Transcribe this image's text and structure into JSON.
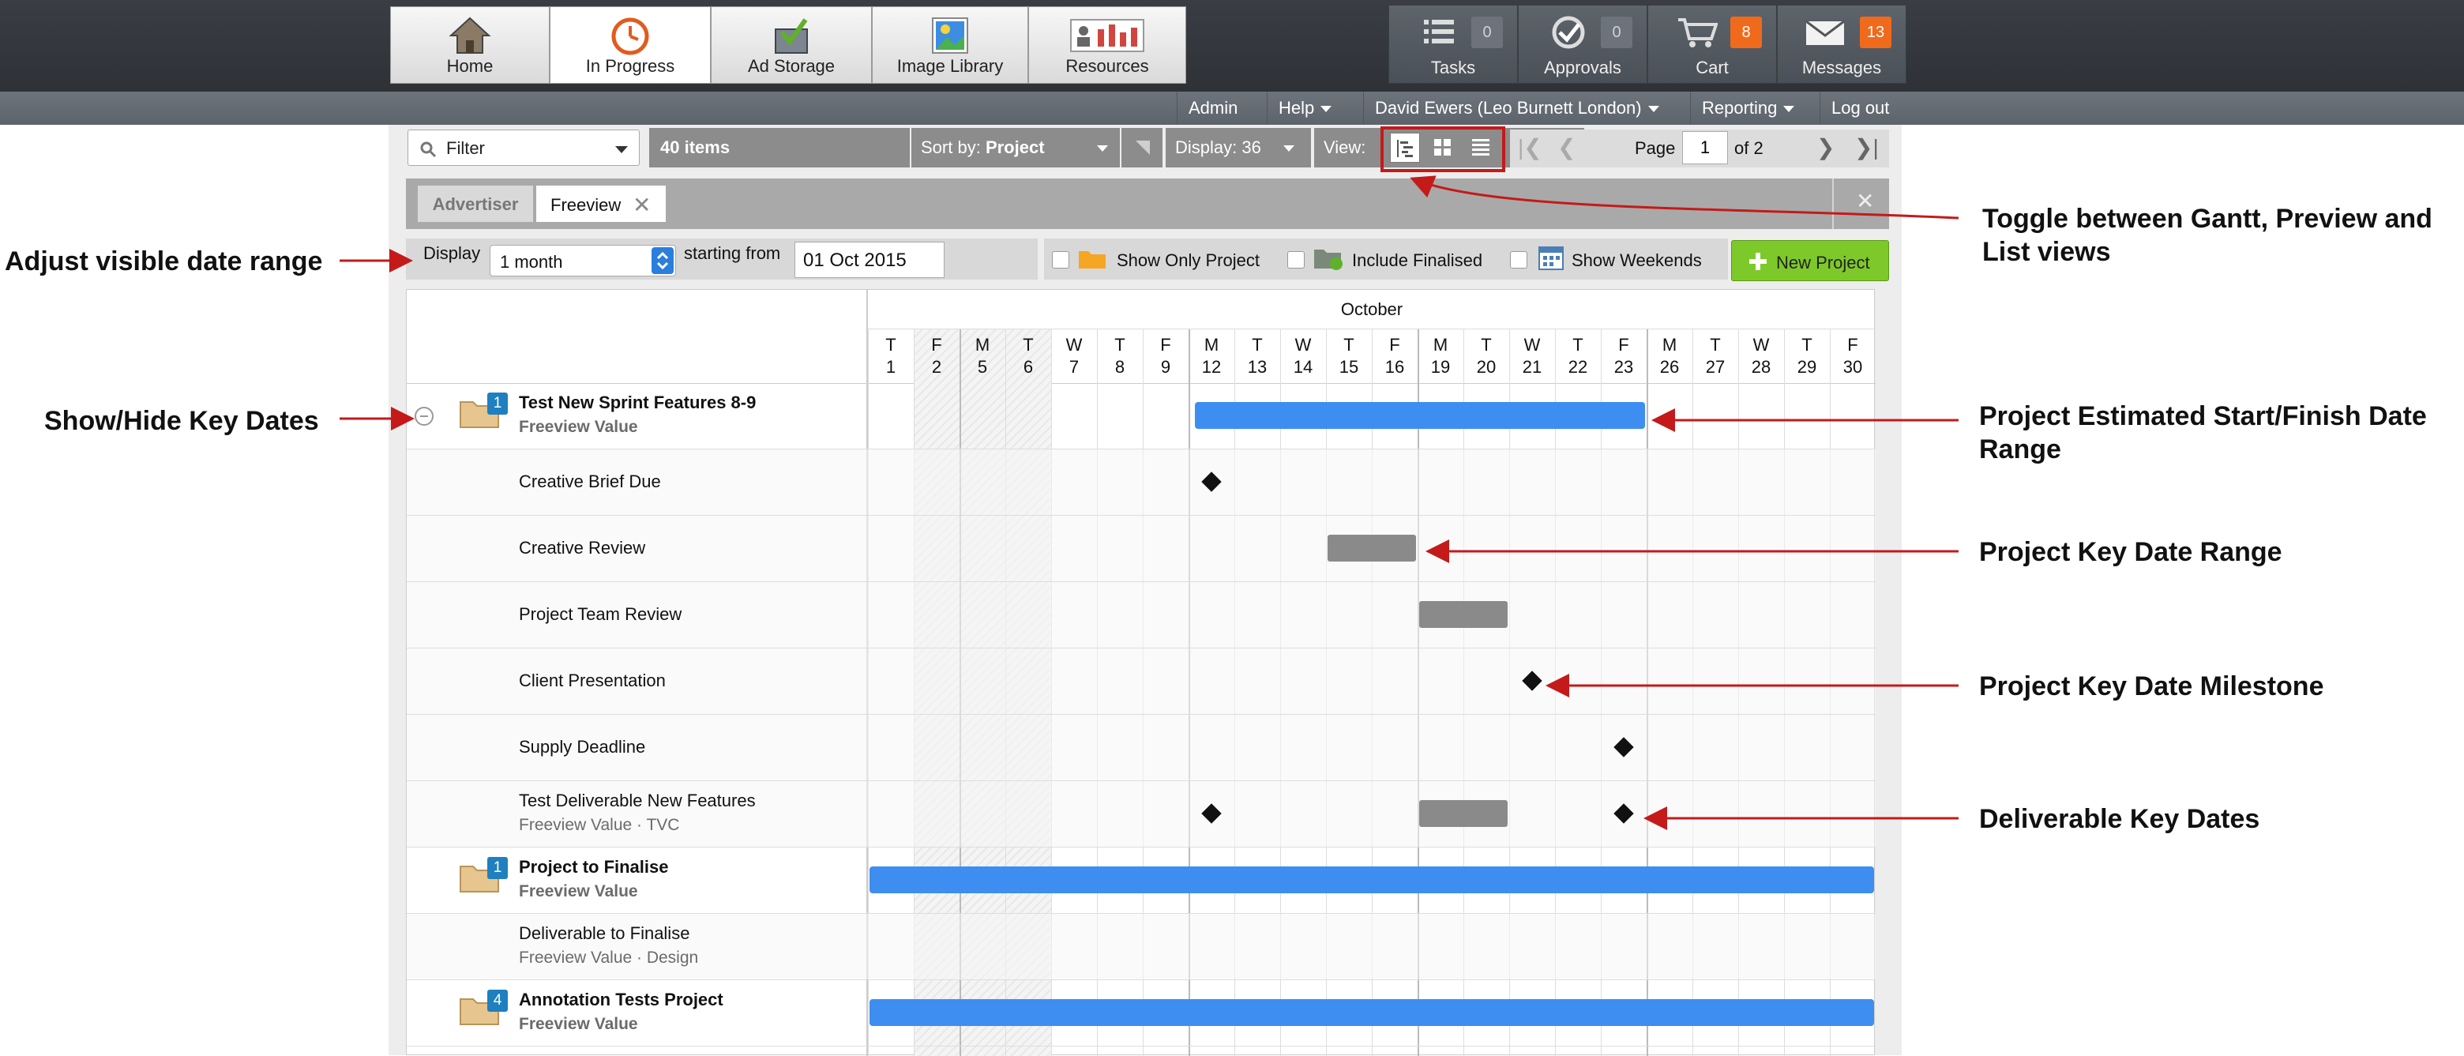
{
  "nav": {
    "tabs": [
      {
        "label": "Home",
        "icon": "home-icon"
      },
      {
        "label": "In Progress",
        "icon": "clock-icon"
      },
      {
        "label": "Ad Storage",
        "icon": "box-icon"
      },
      {
        "label": "Image Library",
        "icon": "image-icon"
      },
      {
        "label": "Resources",
        "icon": "resources-icon"
      }
    ],
    "active_tab": "In Progress"
  },
  "quick": [
    {
      "label": "Tasks",
      "count": "0",
      "icon": "list-icon"
    },
    {
      "label": "Approvals",
      "count": "0",
      "icon": "approval-icon"
    },
    {
      "label": "Cart",
      "count": "8",
      "icon": "cart-icon"
    },
    {
      "label": "Messages",
      "count": "13",
      "icon": "envelope-icon"
    }
  ],
  "menu": {
    "admin": "Admin",
    "help": "Help",
    "user": "David Ewers (Leo Burnett London)",
    "reporting": "Reporting",
    "logout": "Log out"
  },
  "toolbar": {
    "filter": "Filter",
    "items": "40 items",
    "sort_prefix": "Sort by:",
    "sort_value": "Project",
    "display": "Display: 36",
    "view": "View:",
    "page_label": "Page",
    "page_value": "1",
    "page_of": "of 2"
  },
  "filters": {
    "advertiser": "Advertiser",
    "chip": "Freeview"
  },
  "range": {
    "display_label": "Display",
    "display_value": "1 month",
    "starting_from": "starting from",
    "date": "01 Oct 2015",
    "show_only_project": "Show Only Project",
    "include_finalised": "Include Finalised",
    "show_weekends": "Show Weekends",
    "new_project": "New Project"
  },
  "gantt": {
    "month": "October",
    "days": [
      {
        "d": "T",
        "n": "1"
      },
      {
        "d": "F",
        "n": "2"
      },
      {
        "d": "M",
        "n": "5"
      },
      {
        "d": "T",
        "n": "6"
      },
      {
        "d": "W",
        "n": "7"
      },
      {
        "d": "T",
        "n": "8"
      },
      {
        "d": "F",
        "n": "9"
      },
      {
        "d": "M",
        "n": "12"
      },
      {
        "d": "T",
        "n": "13"
      },
      {
        "d": "W",
        "n": "14"
      },
      {
        "d": "T",
        "n": "15"
      },
      {
        "d": "F",
        "n": "16"
      },
      {
        "d": "M",
        "n": "19"
      },
      {
        "d": "T",
        "n": "20"
      },
      {
        "d": "W",
        "n": "21"
      },
      {
        "d": "T",
        "n": "22"
      },
      {
        "d": "F",
        "n": "23"
      },
      {
        "d": "M",
        "n": "26"
      },
      {
        "d": "T",
        "n": "27"
      },
      {
        "d": "W",
        "n": "28"
      },
      {
        "d": "T",
        "n": "29"
      },
      {
        "d": "F",
        "n": "30"
      }
    ],
    "rows": [
      {
        "type": "project",
        "title": "Test New Sprint Features 8-9",
        "sub": "Freeview Value",
        "count": "1",
        "bars": [
          {
            "kind": "blue",
            "from": "12",
            "to": "23"
          }
        ]
      },
      {
        "type": "key",
        "title": "Creative Brief Due",
        "marks": [
          {
            "kind": "diamond",
            "at": "12"
          }
        ]
      },
      {
        "type": "key",
        "title": "Creative Review",
        "bars": [
          {
            "kind": "gray",
            "from": "15",
            "to": "16"
          }
        ]
      },
      {
        "type": "key",
        "title": "Project Team Review",
        "bars": [
          {
            "kind": "gray",
            "from": "19",
            "to": "20"
          }
        ]
      },
      {
        "type": "key",
        "title": "Client Presentation",
        "marks": [
          {
            "kind": "diamond",
            "at": "21"
          }
        ]
      },
      {
        "type": "key",
        "title": "Supply Deadline",
        "marks": [
          {
            "kind": "diamond",
            "at": "23"
          }
        ]
      },
      {
        "type": "deliverable",
        "title": "Test Deliverable New Features",
        "sub": "Freeview Value · TVC",
        "marks": [
          {
            "kind": "diamond",
            "at": "12"
          },
          {
            "kind": "diamond",
            "at": "23"
          }
        ],
        "bars": [
          {
            "kind": "gray",
            "from": "19",
            "to": "20"
          }
        ]
      },
      {
        "type": "project",
        "title": "Project to Finalise",
        "sub": "Freeview Value",
        "count": "1",
        "bars": [
          {
            "kind": "blue",
            "from": "1",
            "to": "30"
          }
        ]
      },
      {
        "type": "deliverable",
        "title": "Deliverable to Finalise",
        "sub": "Freeview Value · Design"
      },
      {
        "type": "project",
        "title": "Annotation Tests Project",
        "sub": "Freeview Value",
        "count": "4",
        "bars": [
          {
            "kind": "blue",
            "from": "1",
            "to": "30"
          }
        ]
      }
    ]
  },
  "annotations": {
    "date_range": "Adjust visible date range",
    "key_dates": "Show/Hide Key Dates",
    "toggle": "Toggle between Gantt, Preview and List views",
    "project_range": "Project Estimated Start/Finish Date Range",
    "key_date_range": "Project Key Date Range",
    "milestone": "Project Key Date Milestone",
    "deliverable": "Deliverable Key Dates"
  },
  "colors": {
    "accent": "#3d8ef0",
    "new_project": "#7ec92a",
    "badge": "#f06a1b",
    "annotation": "#c41a1a"
  }
}
